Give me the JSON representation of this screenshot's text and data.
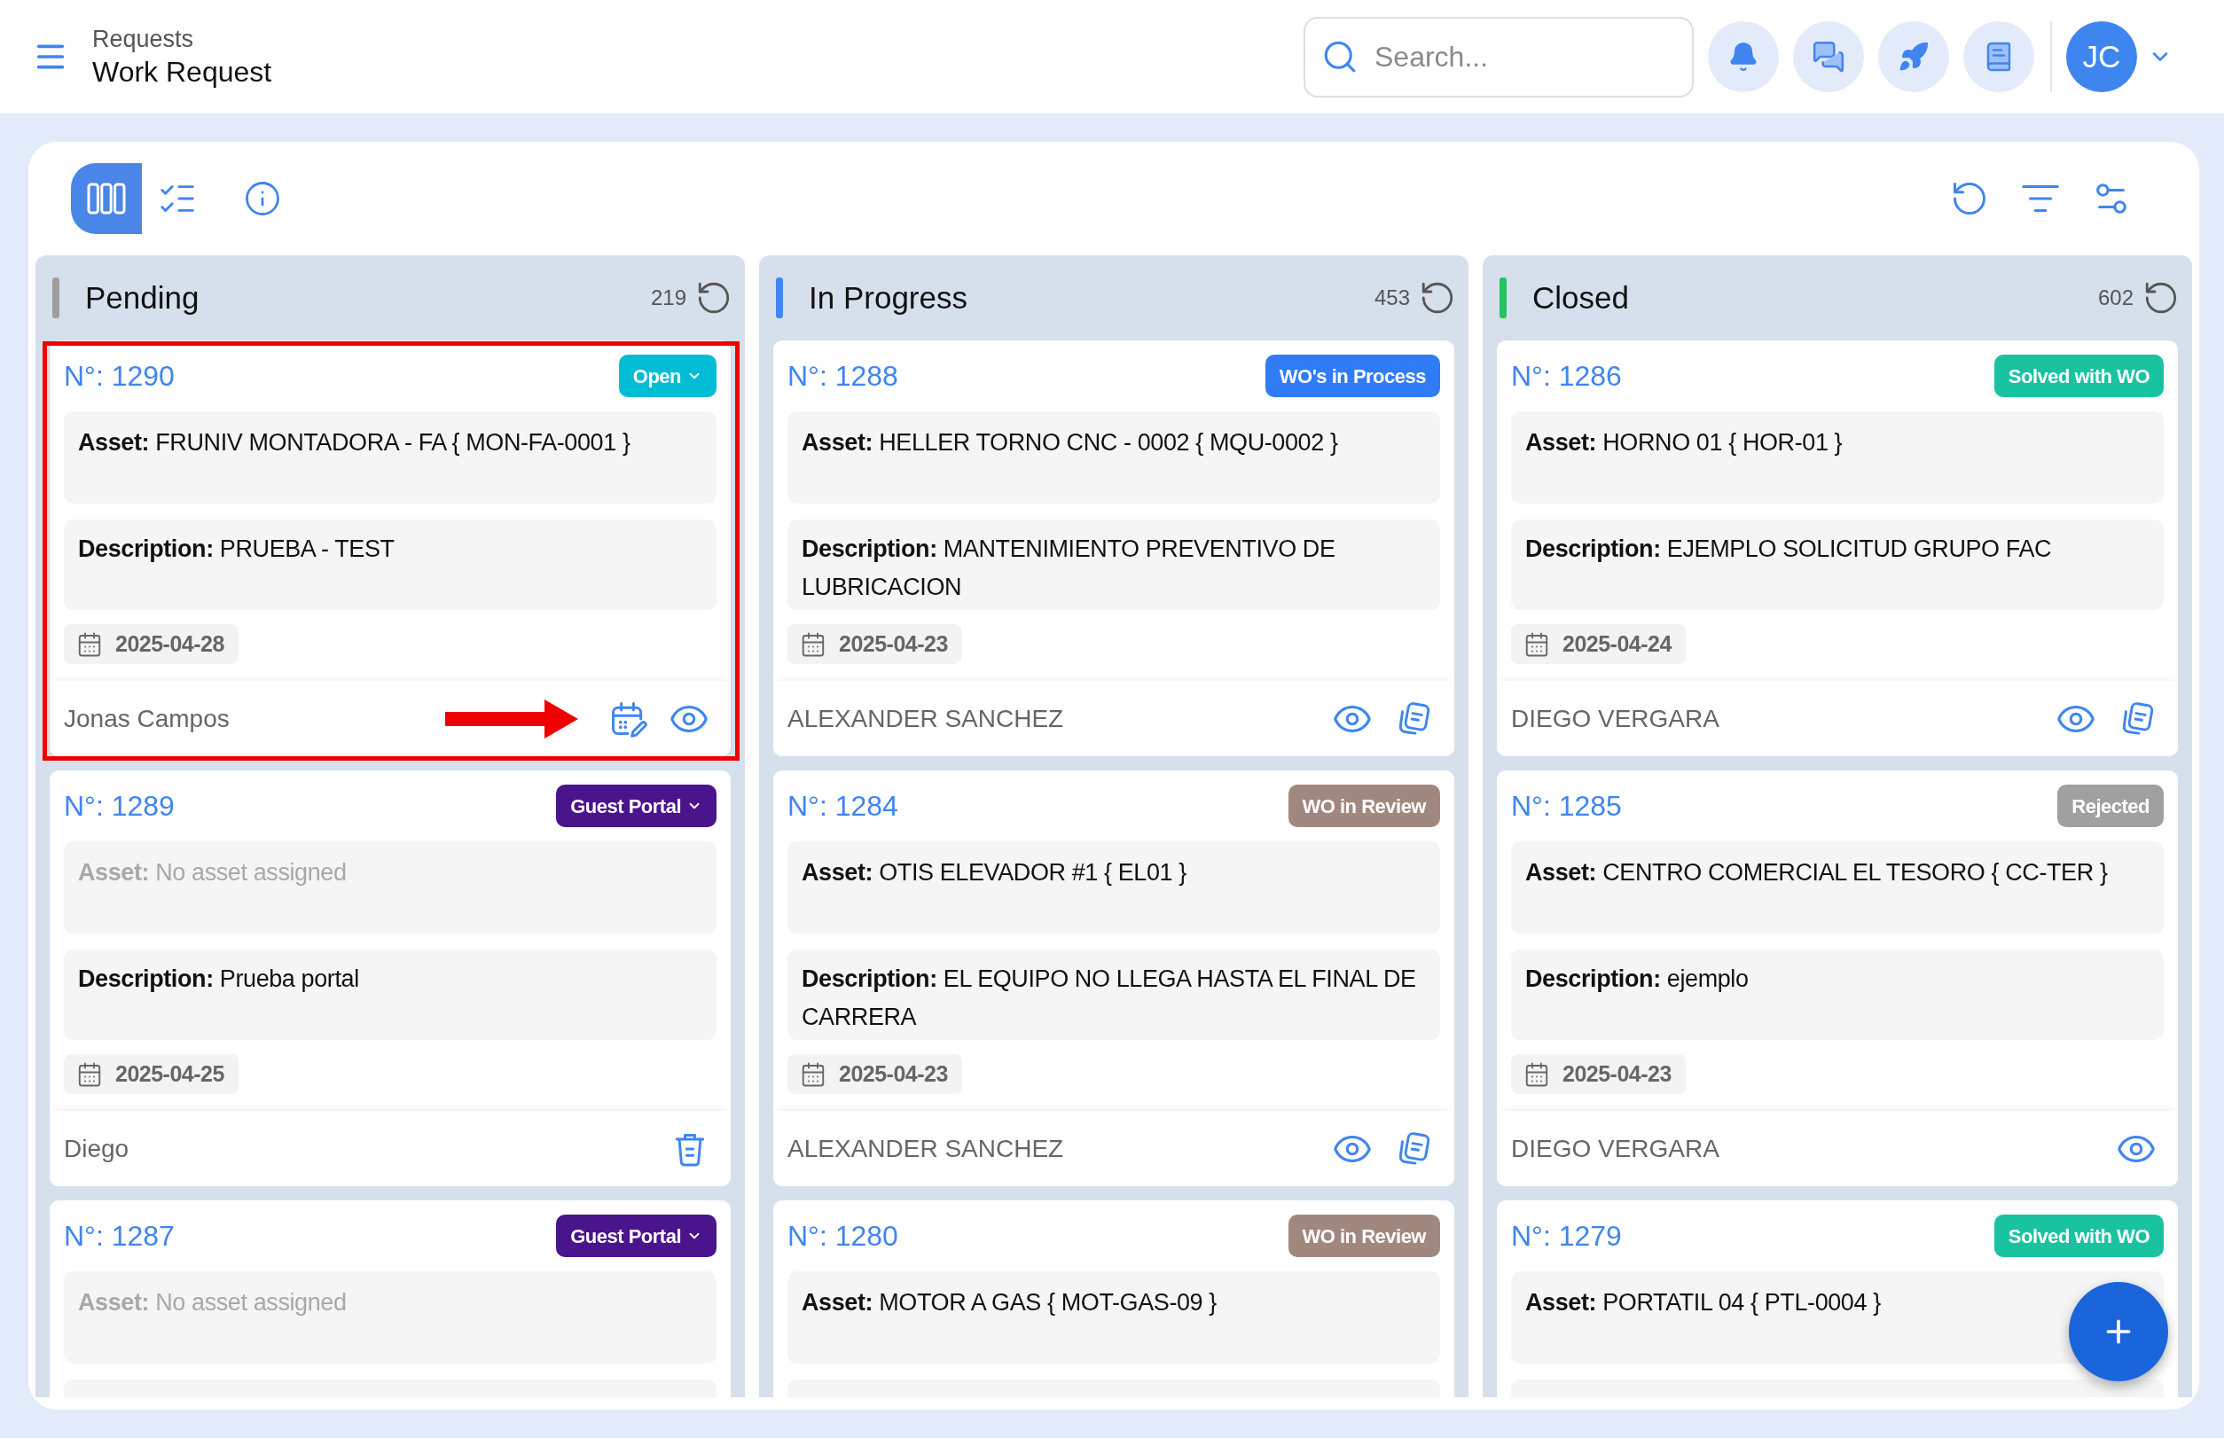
{
  "header": {
    "breadcrumb": "Requests",
    "title": "Work Request",
    "search": {
      "placeholder": "Search..."
    },
    "avatar": {
      "initials": "JC"
    }
  },
  "toolbar": {
    "views": [
      {
        "kind": "board",
        "selected": true
      },
      {
        "kind": "list",
        "selected": false
      }
    ]
  },
  "columns": [
    {
      "title": "Pending",
      "count": "219",
      "color": "#9e9e9e",
      "cards": [
        {
          "number": "N°: 1290",
          "status": {
            "label": "Open",
            "color": "#00bcd4",
            "dropdown": true
          },
          "asset": {
            "text": "**Asset:** FRUNIV MONTADORA - FA { MON-FA-0001 }",
            "empty": false
          },
          "description": "**Description:** PRUEBA - TEST",
          "date": "2025-04-28",
          "requester": "Jonas Campos",
          "actions": [
            {
              "kind": "schedule"
            },
            {
              "kind": "view"
            }
          ],
          "highlighted": true
        },
        {
          "number": "N°: 1289",
          "status": {
            "label": "Guest Portal",
            "color": "#4a148c",
            "dropdown": true
          },
          "asset": {
            "text": "**Asset:** No asset assigned",
            "empty": true
          },
          "description": "**Description:** Prueba portal",
          "date": "2025-04-25",
          "requester": "Diego",
          "actions": [
            {
              "kind": "delete"
            }
          ],
          "highlighted": false
        },
        {
          "number": "N°: 1287",
          "status": {
            "label": "Guest Portal",
            "color": "#4a148c",
            "dropdown": true
          },
          "asset": {
            "text": "**Asset:** No asset assigned",
            "empty": true
          },
          "highlighted": false
        }
      ]
    },
    {
      "title": "In Progress",
      "count": "453",
      "color": "#4285f4",
      "cards": [
        {
          "number": "N°: 1288",
          "status": {
            "label": "WO's in Process",
            "color": "#2f7cf6",
            "dropdown": false
          },
          "asset": {
            "text": "**Asset:** HELLER TORNO CNC - 0002 { MQU-0002 }",
            "empty": false
          },
          "description": "**Description:** MANTENIMIENTO PREVENTIVO DE LUBRICACION",
          "date": "2025-04-23",
          "requester": "ALEXANDER SANCHEZ",
          "actions": [
            {
              "kind": "view"
            },
            {
              "kind": "notes"
            }
          ],
          "highlighted": false
        },
        {
          "number": "N°: 1284",
          "status": {
            "label": "WO in Review",
            "color": "#a1887f",
            "dropdown": false
          },
          "asset": {
            "text": "**Asset:** OTIS ELEVADOR #1 { EL01 }",
            "empty": false
          },
          "description": "**Description:** EL EQUIPO NO LLEGA HASTA EL FINAL DE CARRERA",
          "date": "2025-04-23",
          "requester": "ALEXANDER SANCHEZ",
          "actions": [
            {
              "kind": "view"
            },
            {
              "kind": "notes"
            }
          ],
          "highlighted": false
        },
        {
          "number": "N°: 1280",
          "status": {
            "label": "WO in Review",
            "color": "#a1887f",
            "dropdown": false
          },
          "asset": {
            "text": "**Asset:** MOTOR A GAS { MOT-GAS-09 }",
            "empty": false
          },
          "highlighted": false
        }
      ]
    },
    {
      "title": "Closed",
      "count": "602",
      "color": "#22c55e",
      "cards": [
        {
          "number": "N°: 1286",
          "status": {
            "label": "Solved with WO",
            "color": "#19c3a0",
            "dropdown": false
          },
          "asset": {
            "text": "**Asset:** HORNO 01 { HOR-01 }",
            "empty": false
          },
          "description": "**Description:** EJEMPLO SOLICITUD GRUPO FAC",
          "date": "2025-04-24",
          "requester": "DIEGO VERGARA",
          "actions": [
            {
              "kind": "view"
            },
            {
              "kind": "notes"
            }
          ],
          "highlighted": false
        },
        {
          "number": "N°: 1285",
          "status": {
            "label": "Rejected",
            "color": "#a0a0a0",
            "dropdown": false
          },
          "asset": {
            "text": "**Asset:** CENTRO COMERCIAL EL TESORO { CC-TER }",
            "empty": false
          },
          "description": "**Description:** ejemplo",
          "date": "2025-04-23",
          "requester": "DIEGO VERGARA",
          "actions": [
            {
              "kind": "view"
            }
          ],
          "highlighted": false
        },
        {
          "number": "N°: 1279",
          "status": {
            "label": "Solved with WO",
            "color": "#19c3a0",
            "dropdown": false
          },
          "asset": {
            "text": "**Asset:** PORTATIL 04 { PTL-0004 }",
            "empty": false
          },
          "highlighted": false
        }
      ]
    }
  ]
}
